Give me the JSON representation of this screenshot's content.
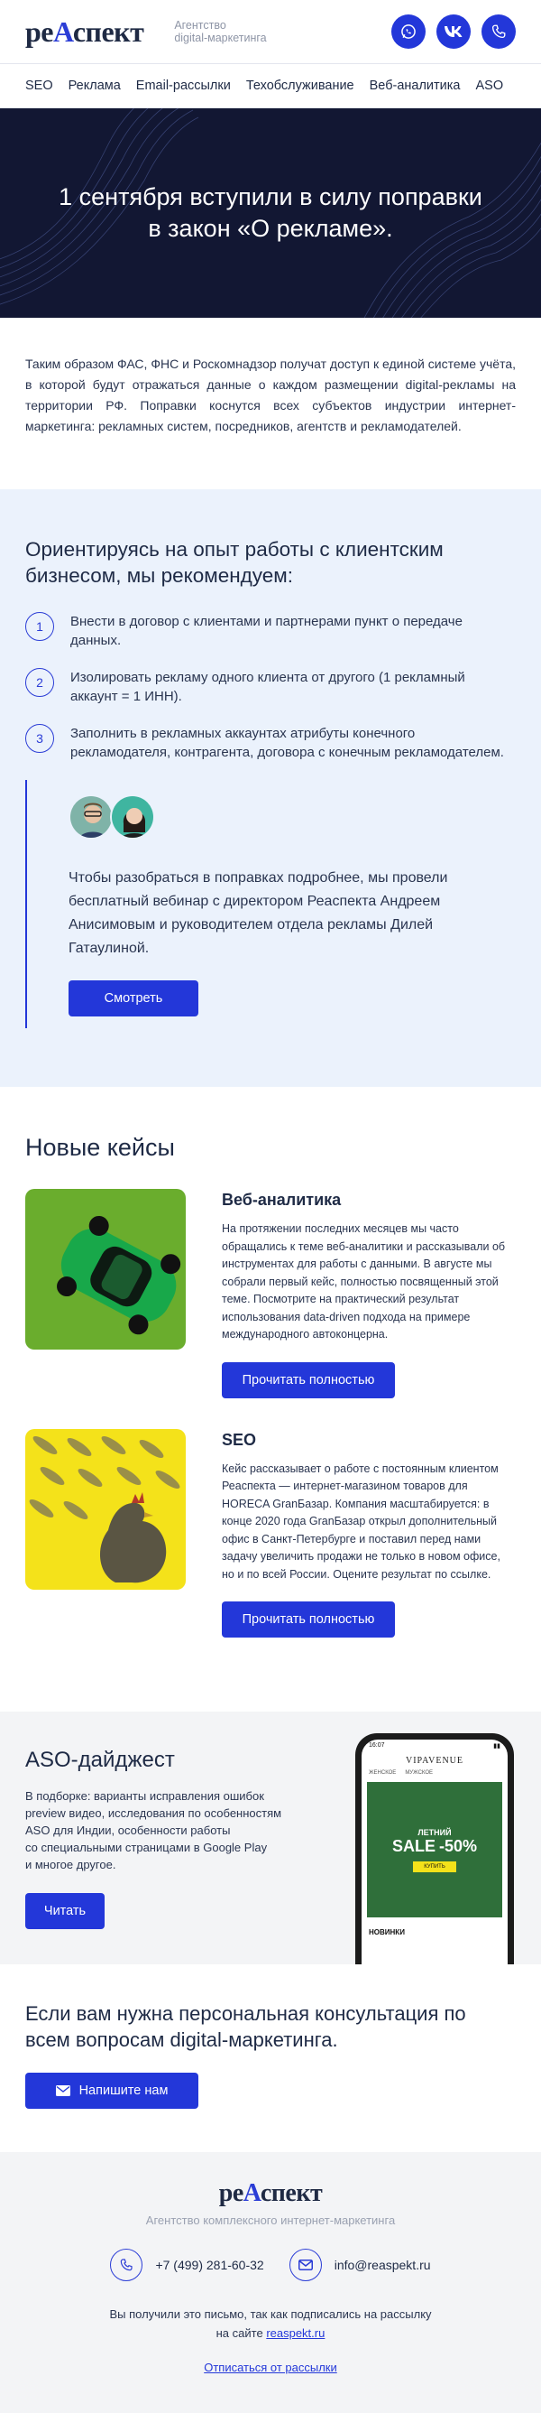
{
  "header": {
    "logo_text": "реАспект",
    "logo_accent_char": "А",
    "tagline_line1": "Агентство",
    "tagline_line2": "digital-маркетинга",
    "social_icons": [
      "whatsapp-icon",
      "vk-icon",
      "phone-icon"
    ]
  },
  "nav": [
    "SEO",
    "Реклама",
    "Email-рассылки",
    "Техобслуживание",
    "Веб-аналитика",
    "ASO"
  ],
  "hero": {
    "title": "1 сентября вступили в силу поправки в закон «О рекламе»."
  },
  "intro": {
    "text": "Таким образом ФАС, ФНС и Роскомнадзор получат доступ к единой системе учёта, в которой будут отражаться данные о каждом размещении digital-рекламы на территории РФ. Поправки коснутся всех субъектов индустрии интернет-маркетинга: рекламных систем, посредников, агентств и рекламодателей."
  },
  "recommend": {
    "title": "Ориентируясь на опыт работы с клиентским бизнесом, мы рекомендуем:",
    "steps": [
      {
        "num": "1",
        "text": "Внести в договор с клиентами и партнерами пункт о передаче данных."
      },
      {
        "num": "2",
        "text": "Изолировать рекламу одного клиента от другого (1 рекламный аккаунт = 1 ИНН)."
      },
      {
        "num": "3",
        "text": "Заполнить в рекламных аккаунтах атрибуты конечного рекламодателя, контрагента, договора с конечным рекламодателем."
      }
    ],
    "webinar_text": "Чтобы разобраться в поправках подробнее, мы провели бесплатный вебинар с директором Реаспекта Андреем Анисимовым и руководителем отдела рекламы Дилей Гатаулиной.",
    "watch_label": "Смотреть"
  },
  "cases": {
    "title": "Новые кейсы",
    "items": [
      {
        "title": "Веб-аналитика",
        "text": "На протяжении последних месяцев мы часто обращались к теме веб-аналитики и рассказывали об инструментах для работы с данными. В августе мы собрали первый кейс, полностью посвященный этой теме. Посмотрите на практический результат использования data-driven подхода на примере международного автоконцерна.",
        "button": "Прочитать полностью"
      },
      {
        "title": "SEO",
        "text": "Кейс рассказывает о работе с постоянным клиентом Реаспекта — интернет-магазином товаров для HORECA GranБазар. Компания масштабируется: в конце 2020 года GranБазар открыл дополнительный офис в Санкт-Петербурге и поставил перед нами задачу увеличить продажи не только в новом офисе, но и по всей России. Оцените результат по ссылке.",
        "button": "Прочитать полностью"
      }
    ]
  },
  "aso": {
    "title": "ASO-дайджест",
    "text_lines": [
      "В подборке: варианты исправления ошибок",
      "preview видео, исследования по особенностям",
      "ASO для Индии, особенности работы",
      "со специальными страницами в Google Play",
      "и многое другое."
    ],
    "button": "Читать",
    "phone": {
      "time": "16:07",
      "brand": "VIPAVENUE",
      "tab1": "ЖЕНСКОЕ",
      "tab2": "МУЖСКОЕ",
      "promo_line1": "ЛЕТНИЙ",
      "promo_line2": "SALE",
      "promo_line3": "-50%",
      "promo_button": "КУПИТЬ",
      "new_label": "НОВИНКИ"
    }
  },
  "consult": {
    "title": "Если вам нужна персональная консультация по всем вопросам digital-маркетинга.",
    "button": "Напишите нам"
  },
  "footer": {
    "logo_text": "реАспект",
    "subtitle": "Агентство комплексного интернет-маркетинга",
    "phone": "+7 (499) 281-60-32",
    "email": "info@reaspekt.ru",
    "note_line1": "Вы получили это письмо, так как подписались на рассылку",
    "note_prefix": "на сайте",
    "site_link": "reaspekt.ru",
    "unsubscribe": "Отписаться от рассылки"
  },
  "colors": {
    "accent": "#2337d9",
    "hero_bg": "#121733",
    "light_bg": "#ebf2fc",
    "grey_bg": "#f3f4f6"
  }
}
